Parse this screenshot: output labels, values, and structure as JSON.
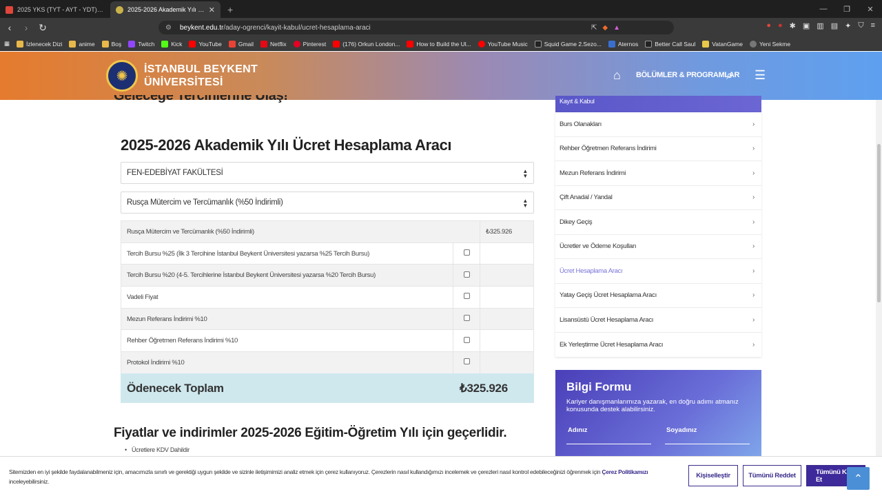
{
  "browser": {
    "tabs": [
      {
        "title": "2025 YKS (TYT - AYT - YDT) Tercih Me",
        "active": false
      },
      {
        "title": "2025-2026 Akademik Yılı Ücret H",
        "active": true
      }
    ],
    "url_host": "beykent.edu.tr",
    "url_path": "/aday-ogrenci/kayit-kabul/ucret-hesaplama-araci",
    "bookmarks": [
      "İzlenecek Dizi",
      "anime",
      "Boş",
      "Twitch",
      "Kick",
      "YouTube",
      "Gmail",
      "Netflix",
      "Pinterest",
      "(176) Orkun London...",
      "How to Build the Ul...",
      "YouTube Music",
      "Squid Game 2.Sezo...",
      "Aternos",
      "Better Call Saul",
      "VatanGame",
      "Yeni Sekme"
    ]
  },
  "header": {
    "logo_line1": "İSTANBUL BEYKENT",
    "logo_line2": "ÜNİVERSİTESİ",
    "programs_label": "BÖLÜMLER & PROGRAMLAR"
  },
  "main": {
    "cut_heading": "Geleceğe Tercihlerine Ulaş!",
    "title": "2025-2026 Akademik Yılı Ücret Hesaplama Aracı",
    "faculty_select": "FEN-EDEBİYAT FAKÜLTESİ",
    "program_select": "Rusça Mütercim ve Tercümanlık (%50 İndirimli)",
    "fee_row": {
      "label": "Rusça Mütercim ve Tercümanlık (%50 İndirimli)",
      "amount": "₺325.926"
    },
    "discounts": [
      {
        "label": "Tercih Bursu %25 (İlk 3 Tercihine İstanbul Beykent Üniversitesi yazarsa %25 Tercih Bursu)",
        "checked": false
      },
      {
        "label": "Tercih Bursu %20 (4-5. Tercihlerine İstanbul Beykent Üniversitesi yazarsa %20 Tercih Bursu)",
        "checked": false
      },
      {
        "label": "Vadeli Fiyat",
        "checked": false
      },
      {
        "label": "Mezun Referans İndirimi %10",
        "checked": false
      },
      {
        "label": "Rehber Öğretmen Referans İndirimi %10",
        "checked": false
      },
      {
        "label": "Protokol İndirimi %10",
        "checked": false
      }
    ],
    "total_label": "Ödenecek Toplam",
    "total_value": "₺325.926",
    "validity_note": "Fiyatlar ve indirimler 2025-2026 Eğitim-Öğretim Yılı için geçerlidir.",
    "vat_note": "Ücretlere KDV Dahildir"
  },
  "sidebar": {
    "header": "Kayıt & Kabul",
    "items": [
      {
        "label": "Burs Olanakları",
        "active": false
      },
      {
        "label": "Rehber Öğretmen Referans İndirimi",
        "active": false
      },
      {
        "label": "Mezun Referans İndirimi",
        "active": false
      },
      {
        "label": "Çift Anadal / Yandal",
        "active": false
      },
      {
        "label": "Dikey Geçiş",
        "active": false
      },
      {
        "label": "Ücretler ve Ödeme Koşulları",
        "active": false
      },
      {
        "label": "Ücret Hesaplama Aracı",
        "active": true
      },
      {
        "label": "Yatay Geçiş Ücret Hesaplama Aracı",
        "active": false
      },
      {
        "label": "Lisansüstü Ücret Hesaplama Aracı",
        "active": false
      },
      {
        "label": "Ek Yerleştirme Ücret Hesaplama Aracı",
        "active": false
      }
    ]
  },
  "info_form": {
    "title": "Bilgi Formu",
    "description": "Kariyer danışmanlarımıza yazarak, en doğru adımı atmanız konusunda destek alabilirsiniz.",
    "first_name_label": "Adınız",
    "last_name_label": "Soyadınız"
  },
  "cookie": {
    "text": "Sitemizden en iyi şekilde faydalanabilmeniz için, amacımızla sınırlı ve gerektiği uygun şekilde ve sizinle iletişimimizi analiz etmek için çerez kullanıyoruz. Çerezlerin nasıl kullandığımızı incelemek ve çerezleri nasıl kontrol edebileceğinizi öğrenmek için ",
    "policy_link": "Çerez Politikamızı",
    "text_end": " inceleyebilirsiniz.",
    "customize_label": "Kişiselleştir",
    "reject_label": "Tümünü Reddet",
    "accept_label": "Tümünü Kabul Et"
  },
  "colors": {
    "accent": "#3e2a9a",
    "sidebar_active": "#7a73d8",
    "total_bg": "#cfe8ee"
  }
}
